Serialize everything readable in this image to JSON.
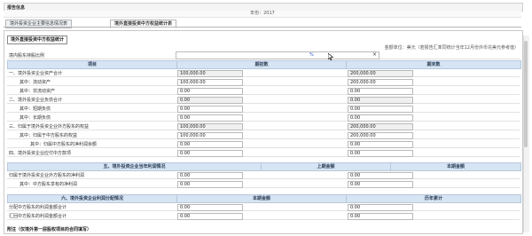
{
  "header": {
    "title": "报告信息",
    "year_label": "年份：2017"
  },
  "tabs": [
    {
      "label": "境外投资企业主要信息情况表",
      "active": false
    },
    {
      "label": "境外直接投资中方权益统计表",
      "active": true
    }
  ],
  "section": {
    "title": "境外直接投资中方权益统计",
    "unit_note": "金额单位：美元（若报告汇率同统计当年12月份外币兑美元参考值）",
    "proportion_label": "境内股东持股比例",
    "proportion_value": "%"
  },
  "table": {
    "headers": {
      "item": "项目",
      "begin": "期初数",
      "end": "期末数"
    },
    "rows": [
      {
        "label": "一、境外投资企业资产合计",
        "begin": "100,000.00",
        "end": "200,000.00"
      },
      {
        "label": "其中：流动资产",
        "begin": "100,000.00",
        "end": "200,000.00"
      },
      {
        "label": "其中：非流动资产",
        "begin": "0.00",
        "end": "0.00"
      },
      {
        "label": "二、境外投资企业负债合计",
        "begin": "0.00",
        "end": "0.00"
      },
      {
        "label": "其中：短期负债",
        "begin": "0.00",
        "end": "0.00"
      },
      {
        "label": "其中：长期负债",
        "begin": "0.00",
        "end": "0.00"
      },
      {
        "label": "三、归属于境外投资企业外方股东的权益",
        "begin": "100,000.00",
        "end": "200,000.00"
      },
      {
        "label": "其中：归属于中方股东的权益",
        "begin": "100,000.00",
        "end": "200,000.00"
      },
      {
        "label": "其中：归属中方股东的净利润余额",
        "begin": "0.00",
        "end": "0.00"
      },
      {
        "label": "四、境外投资企业应付中方款项",
        "begin": "0.00",
        "end": "0.00"
      }
    ],
    "sub_headers_5": {
      "title": "五、境外投资企业当年利润情况",
      "prev": "上期金额",
      "curr": "本期金额"
    },
    "rows_5": [
      {
        "label": "归属于境外投资企业外方股东的净利润",
        "prev": "0.00",
        "curr": "0.00"
      },
      {
        "label": "其中：中方股东享有的净利润",
        "prev": "0.00",
        "curr": "0.00"
      }
    ],
    "sub_headers_6": {
      "title": "六、境外投资企业利润分配情况",
      "curr": "本期金额",
      "cum": "历年累计"
    },
    "rows_6": [
      {
        "label": "分配中方股东的利润金额合计",
        "curr": "0.00",
        "cum": "0.00"
      },
      {
        "label": "汇回中方股东的利润金额合计",
        "curr": "0.00",
        "cum": "0.00"
      }
    ],
    "footnote": "附注（仅境外第一层股权项目的合同填写）"
  }
}
